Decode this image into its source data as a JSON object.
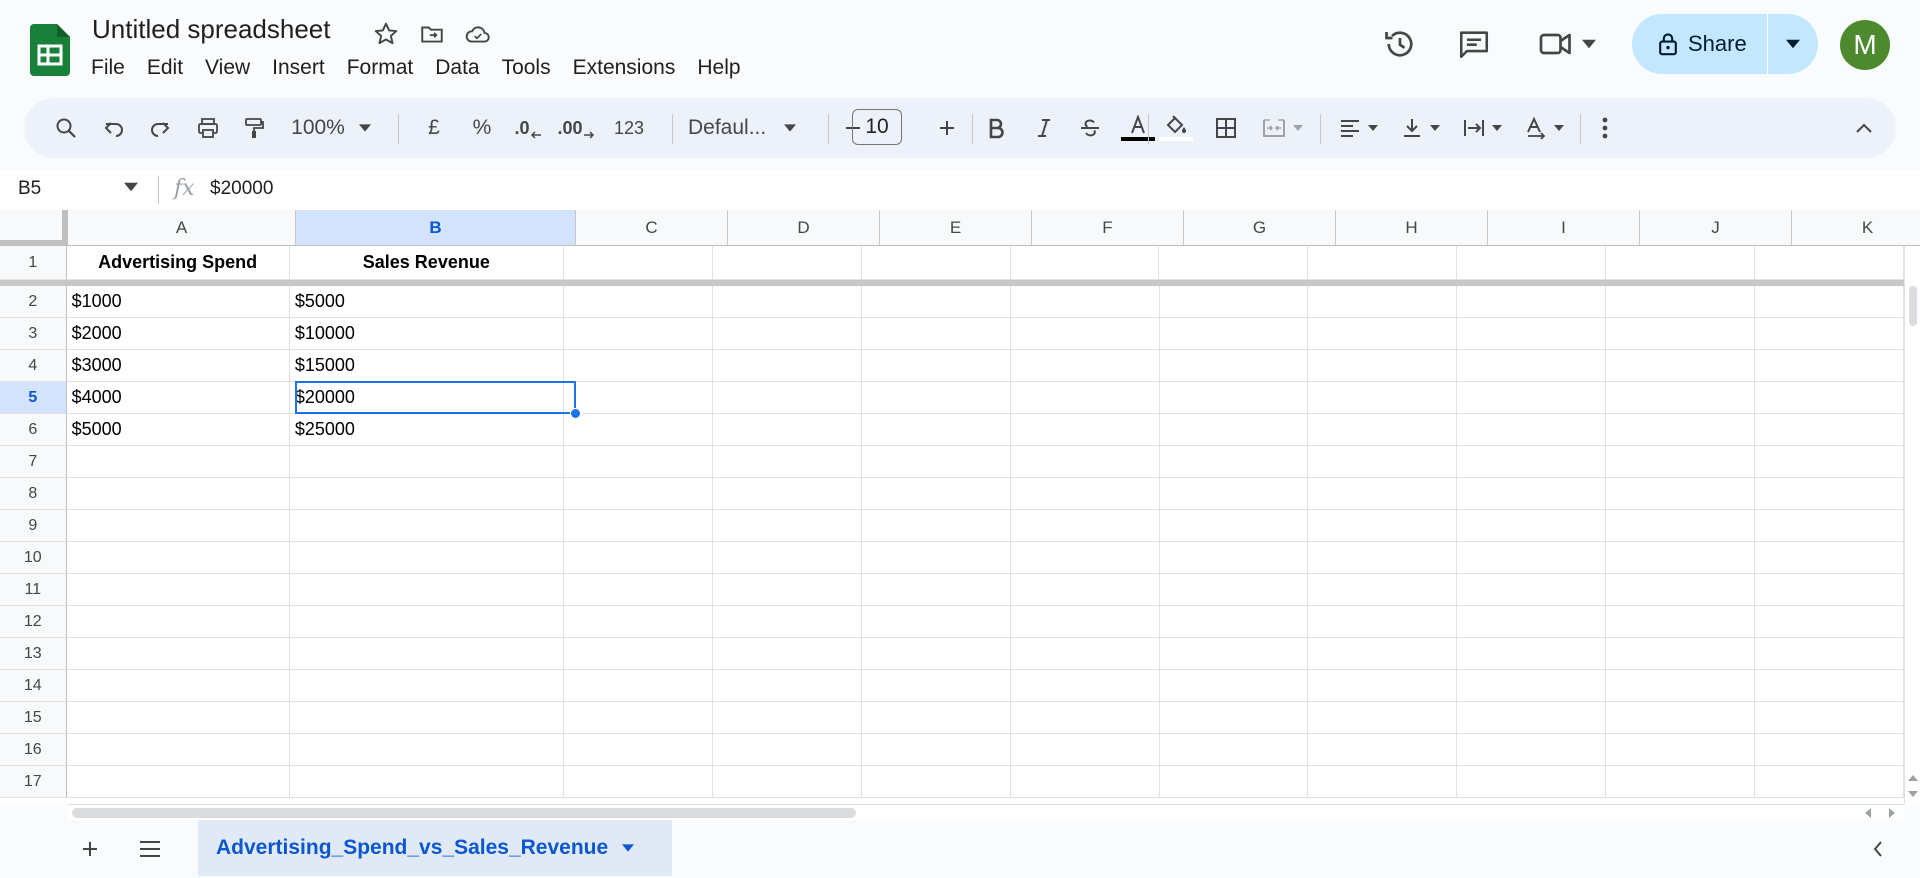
{
  "app": {
    "title": "Untitled spreadsheet",
    "menu": [
      "File",
      "Edit",
      "View",
      "Insert",
      "Format",
      "Data",
      "Tools",
      "Extensions",
      "Help"
    ],
    "share_label": "Share",
    "avatar_initial": "M"
  },
  "toolbar": {
    "zoom": "100%",
    "currency": "£",
    "percent": "%",
    "dec_decrease": ".0",
    "dec_increase": ".00",
    "number_format": "123",
    "font": "Defaul...",
    "font_size": "10"
  },
  "formula_bar": {
    "cell_ref": "B5",
    "fx": "fx",
    "value": "$20000"
  },
  "grid": {
    "columns": [
      "A",
      "B",
      "C",
      "D",
      "E",
      "F",
      "G",
      "H",
      "I",
      "J",
      "K"
    ],
    "active_column": "B",
    "active_row": "5",
    "rows": [
      {
        "num": "1",
        "cells": [
          "Advertising Spend",
          "Sales Revenue"
        ]
      },
      {
        "num": "2",
        "cells": [
          "$1000",
          "$5000"
        ]
      },
      {
        "num": "3",
        "cells": [
          "$2000",
          "$10000"
        ]
      },
      {
        "num": "4",
        "cells": [
          "$3000",
          "$15000"
        ]
      },
      {
        "num": "5",
        "cells": [
          "$4000",
          "$20000"
        ]
      },
      {
        "num": "6",
        "cells": [
          "$5000",
          "$25000"
        ]
      },
      {
        "num": "7",
        "cells": []
      },
      {
        "num": "8",
        "cells": []
      },
      {
        "num": "9",
        "cells": []
      },
      {
        "num": "10",
        "cells": []
      },
      {
        "num": "11",
        "cells": []
      },
      {
        "num": "12",
        "cells": []
      },
      {
        "num": "13",
        "cells": []
      },
      {
        "num": "14",
        "cells": []
      },
      {
        "num": "15",
        "cells": []
      },
      {
        "num": "16",
        "cells": []
      },
      {
        "num": "17",
        "cells": []
      }
    ]
  },
  "sheets": {
    "active": "Advertising_Spend_vs_Sales_Revenue"
  },
  "colors": {
    "accent": "#1a73e8",
    "brand_green": "#188038",
    "share_bg": "#c2e7ff",
    "avatar_bg": "#4d8a2e"
  }
}
